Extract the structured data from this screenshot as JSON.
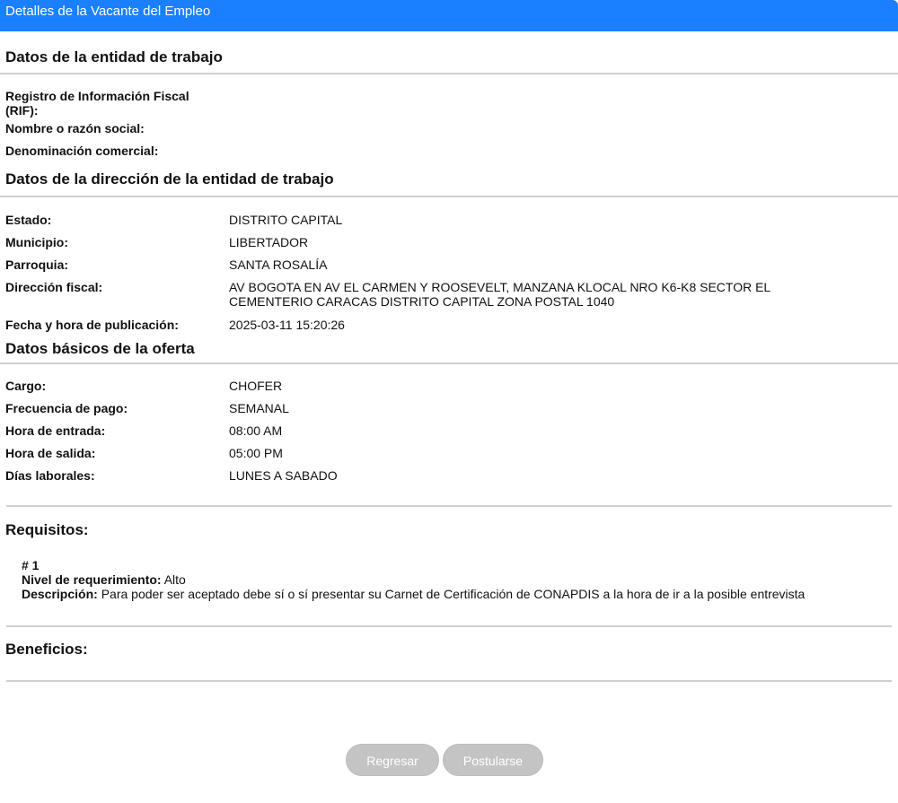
{
  "window": {
    "title": "Detalles de la Vacante del Empleo"
  },
  "sections": {
    "entity": "Datos de la entidad de trabajo",
    "address": "Datos de la dirección de la entidad de trabajo",
    "offer": "Datos básicos de la oferta",
    "requirements": "Requisitos:",
    "benefits": "Beneficios:"
  },
  "entity": {
    "rif_label": "Registro de Información Fiscal (RIF):",
    "rif_value": "",
    "name_label": "Nombre o razón social:",
    "name_value": "",
    "commercial_label": "Denominación comercial:",
    "commercial_value": ""
  },
  "address": {
    "estado_label": "Estado:",
    "estado_value": "DISTRITO CAPITAL",
    "municipio_label": "Municipio:",
    "municipio_value": "LIBERTADOR",
    "parroquia_label": "Parroquia:",
    "parroquia_value": "SANTA ROSALÍA",
    "direccion_label": "Dirección fiscal:",
    "direccion_value": "AV BOGOTA EN AV EL CARMEN Y ROOSEVELT, MANZANA KLOCAL NRO K6-K8 SECTOR EL CEMENTERIO CARACAS DISTRITO CAPITAL ZONA POSTAL 1040",
    "fecha_label": "Fecha y hora de publicación:",
    "fecha_value": "2025-03-11 15:20:26"
  },
  "offer": {
    "cargo_label": "Cargo:",
    "cargo_value": "CHOFER",
    "frecuencia_label": "Frecuencia de pago:",
    "frecuencia_value": "SEMANAL",
    "entrada_label": "Hora de entrada:",
    "entrada_value": "08:00 AM",
    "salida_label": "Hora de salida:",
    "salida_value": "05:00 PM",
    "dias_label": "Días laborales:",
    "dias_value": "LUNES A SABADO"
  },
  "requirements": [
    {
      "number": "# 1",
      "level_label": "Nivel de requerimiento:",
      "level_value": "Alto",
      "desc_label": "Descripción:",
      "desc_value": "Para poder ser aceptado debe sí o sí presentar su Carnet de Certificación de CONAPDIS a la hora de ir a la posible entrevista"
    }
  ],
  "buttons": {
    "back": "Regresar",
    "apply": "Postularse"
  },
  "colors": {
    "titlebar": "#1a80ff",
    "button_bg": "#c4c4c4",
    "divider": "#cfcfcf"
  }
}
